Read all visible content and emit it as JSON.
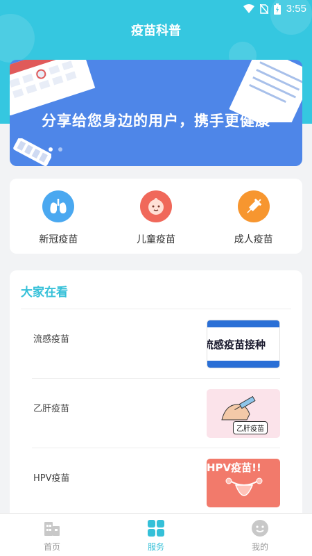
{
  "status_bar": {
    "time": "3:55"
  },
  "header": {
    "title": "疫苗科普"
  },
  "banner": {
    "text": "分享给您身边的用户，携手更健康"
  },
  "categories": [
    {
      "label": "新冠疫苗",
      "icon": "lungs-icon",
      "color": "#4aa8f0"
    },
    {
      "label": "儿童疫苗",
      "icon": "baby-face-icon",
      "color": "#f0685a"
    },
    {
      "label": "成人疫苗",
      "icon": "syringe-icon",
      "color": "#f7962f"
    }
  ],
  "popular": {
    "title": "大家在看",
    "articles": [
      {
        "title": "流感疫苗",
        "thumb_text": "流感疫苗接种"
      },
      {
        "title": "乙肝疫苗",
        "thumb_text": "乙肝疫苗"
      },
      {
        "title": "HPV疫苗",
        "thumb_text": "HPV疫苗!!"
      }
    ]
  },
  "tabbar": {
    "tabs": [
      {
        "label": "首页",
        "icon": "home-building-icon",
        "active": false
      },
      {
        "label": "服务",
        "icon": "grid-icon",
        "active": true
      },
      {
        "label": "我的",
        "icon": "smiley-icon",
        "active": false
      }
    ]
  },
  "colors": {
    "accent": "#35c7e0",
    "banner": "#4e86e8"
  }
}
